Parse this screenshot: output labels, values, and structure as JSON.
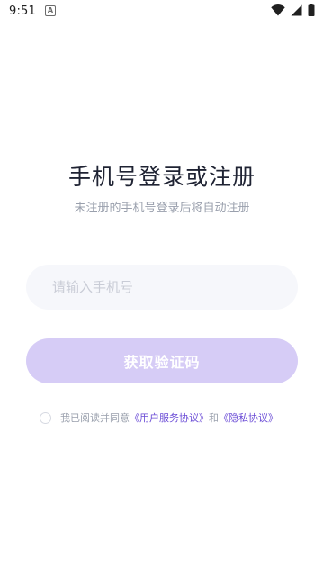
{
  "status_bar": {
    "time": "9:51",
    "notification_badge": "A",
    "icons": [
      "wifi-icon",
      "cell-signal-icon",
      "battery-icon"
    ]
  },
  "login": {
    "title": "手机号登录或注册",
    "subtitle": "未注册的手机号登录后将自动注册",
    "phone_placeholder": "请输入手机号",
    "phone_value": "",
    "get_code_label": "获取验证码"
  },
  "agreement": {
    "checked": false,
    "prefix": "我已阅读并同意",
    "user_agreement": "《用户服务协议》",
    "conjunction": "和",
    "privacy_policy": "《隐私协议》"
  },
  "colors": {
    "accent": "#6a4bd6",
    "button_bg": "#d6ccf6",
    "input_bg": "#f6f7fb",
    "title": "#1f2333",
    "muted": "#9aa0ad"
  }
}
